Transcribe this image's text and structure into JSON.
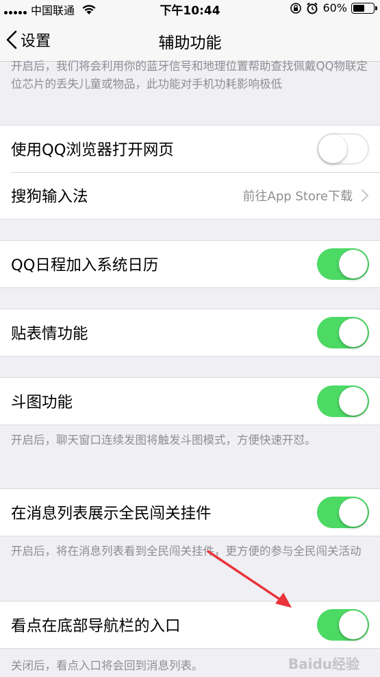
{
  "status_bar": {
    "carrier": "中国联通",
    "time": "下午10:44",
    "battery": "60%",
    "battery_level": 0.6
  },
  "nav": {
    "back_label": "设置",
    "title": "辅助功能"
  },
  "top_note": "开启后，我们将会利用你的蓝牙信号和地理位置帮助查找佩戴QQ物联定位芯片的丢失儿童或物品，此功能对手机功耗影响极低",
  "rows": {
    "qq_browser": {
      "label": "使用QQ浏览器打开网页",
      "state": "off"
    },
    "sogou": {
      "label": "搜狗输入法",
      "detail": "前往App Store下载"
    },
    "calendar": {
      "label": "QQ日程加入系统日历",
      "state": "on"
    },
    "sticker": {
      "label": "贴表情功能",
      "state": "on"
    },
    "doutu": {
      "label": "斗图功能",
      "state": "on",
      "note": "开启后，聊天窗口连续发图将触发斗图模式，方便快速开怼。"
    },
    "game_widget": {
      "label": "在消息列表展示全民闯关挂件",
      "state": "on",
      "note": "开启后，将在消息列表看到全民闯关挂件，更方便的参与全民闯关活动"
    },
    "kandian": {
      "label": "看点在底部导航栏的入口",
      "state": "on",
      "note": "关闭后，看点入口将会回到消息列表。"
    }
  },
  "watermark": "Baidu经验",
  "colors": {
    "toggle_on": "#4cd964",
    "annotation_arrow": "#e8343a"
  }
}
